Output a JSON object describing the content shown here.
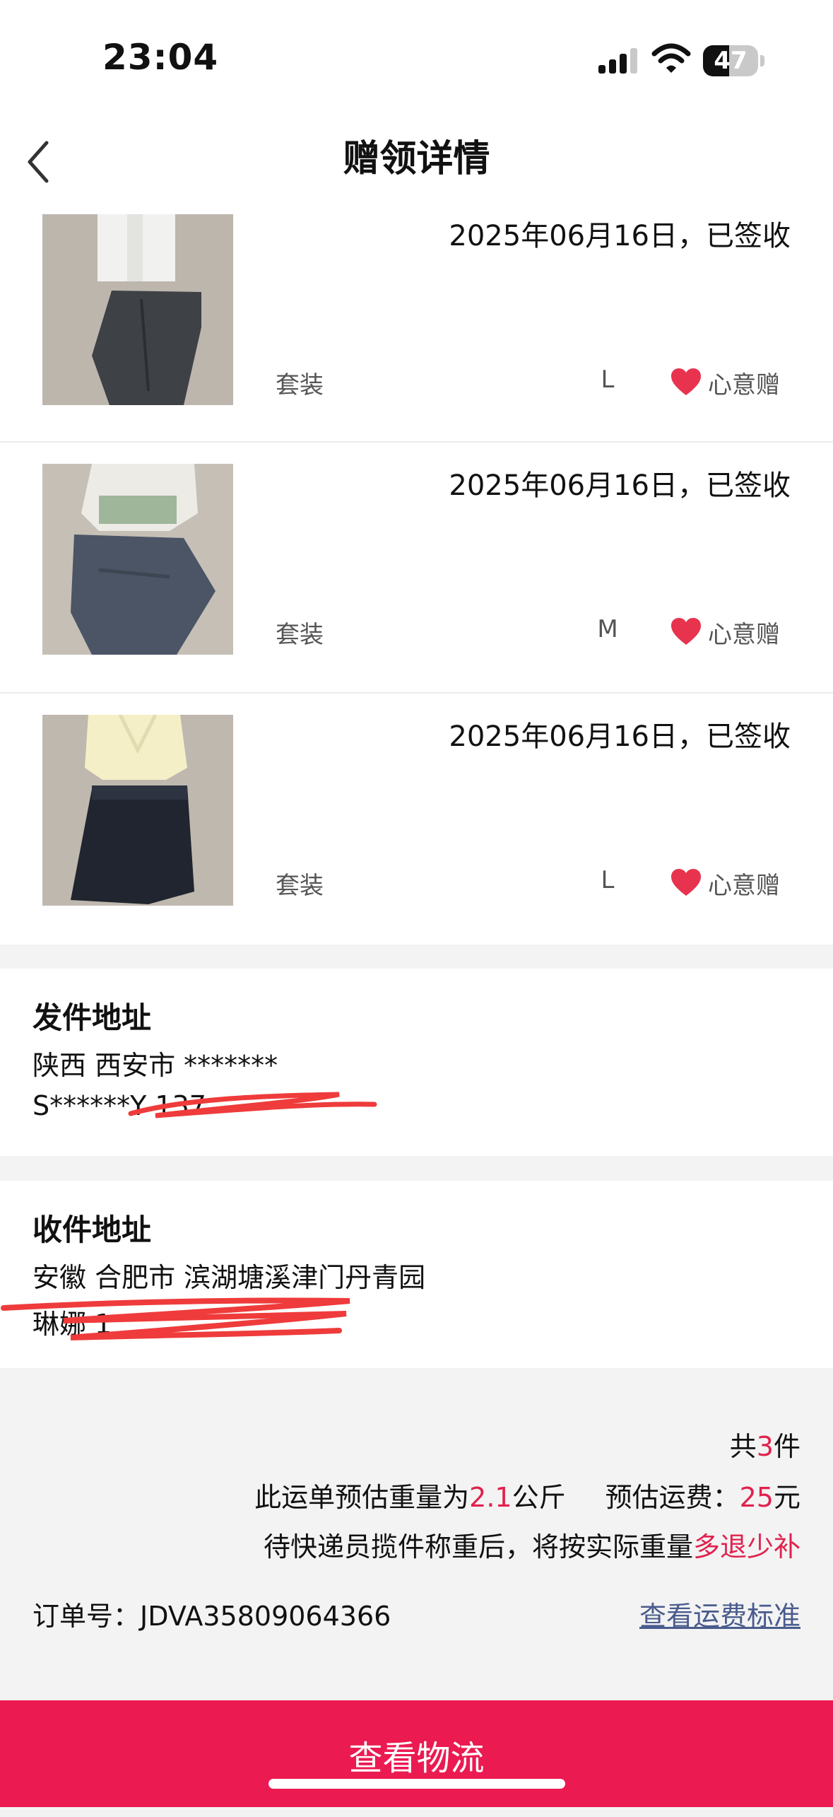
{
  "status_bar": {
    "time": "23:04",
    "battery_level": "47",
    "battery_fraction": 0.47
  },
  "nav": {
    "title": "赠领详情"
  },
  "items": [
    {
      "status": "2025年06月16日，已签收",
      "type": "套装",
      "size": "L",
      "tag": "心意赠"
    },
    {
      "status": "2025年06月16日，已签收",
      "type": "套装",
      "size": "M",
      "tag": "心意赠"
    },
    {
      "status": "2025年06月16日，已签收",
      "type": "套装",
      "size": "L",
      "tag": "心意赠"
    }
  ],
  "sender": {
    "heading": "发件地址",
    "address": "陕西 西安市 *******",
    "contact": "S******Y 137"
  },
  "receiver": {
    "heading": "收件地址",
    "address": "安徽 合肥市 滨湖塘溪津门丹青园",
    "contact": "琳娜 1"
  },
  "summary": {
    "count_prefix": "共",
    "count": "3",
    "count_suffix": "件",
    "weight_prefix": "此运单预估重量为",
    "weight": "2.1",
    "weight_unit": "公斤",
    "fee_label": "预估运费：",
    "fee": "25",
    "fee_unit": "元",
    "note_prefix": "待快递员揽件称重后，将按实际重量",
    "note_highlight": "多退少补",
    "order_label": "订单号：",
    "order_number": "JDVA35809064366",
    "freight_link": "查看运费标准"
  },
  "button": {
    "label": "查看物流"
  },
  "colors": {
    "accent": "#e0224e",
    "button": "#eb1a51",
    "link": "#4a5c8d",
    "heart": "#e8334f"
  }
}
